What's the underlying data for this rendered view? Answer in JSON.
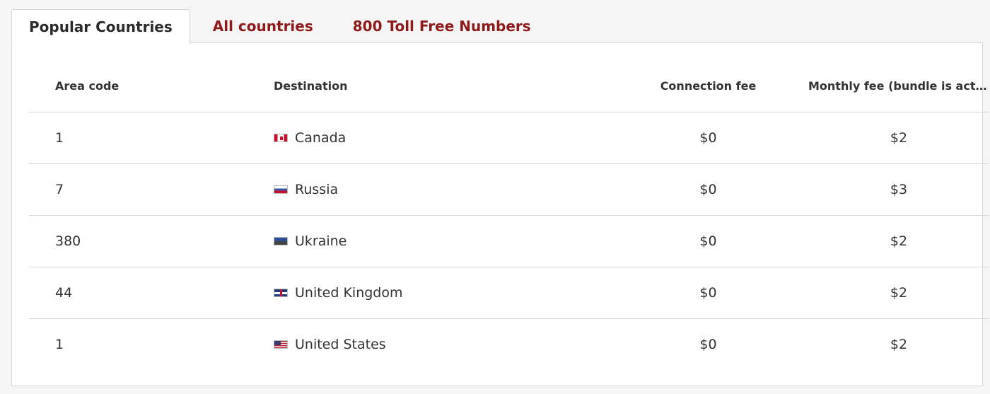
{
  "tabs": [
    {
      "label": "Popular Countries",
      "active": true
    },
    {
      "label": "All countries",
      "active": false
    },
    {
      "label": "800 Toll Free Numbers",
      "active": false
    }
  ],
  "table": {
    "headers": {
      "area_code": "Area code",
      "destination": "Destination",
      "connection_fee": "Connection fee",
      "monthly_fee": "Monthly fee (bundle is active for ..."
    },
    "rows": [
      {
        "area_code": "1",
        "destination": "Canada",
        "flag": "canada-flag-icon",
        "connection_fee": "$0",
        "monthly_fee": "$2"
      },
      {
        "area_code": "7",
        "destination": "Russia",
        "flag": "russia-flag-icon",
        "connection_fee": "$0",
        "monthly_fee": "$3"
      },
      {
        "area_code": "380",
        "destination": "Ukraine",
        "flag": "ukraine-flag-icon",
        "connection_fee": "$0",
        "monthly_fee": "$2"
      },
      {
        "area_code": "44",
        "destination": "United Kingdom",
        "flag": "uk-flag-icon",
        "connection_fee": "$0",
        "monthly_fee": "$2"
      },
      {
        "area_code": "1",
        "destination": "United States",
        "flag": "us-flag-icon",
        "connection_fee": "$0",
        "monthly_fee": "$2"
      }
    ]
  },
  "colors": {
    "tab_link": "#8e1b1b",
    "tab_active": "#2b2b2b",
    "border": "#d7d7d7"
  }
}
